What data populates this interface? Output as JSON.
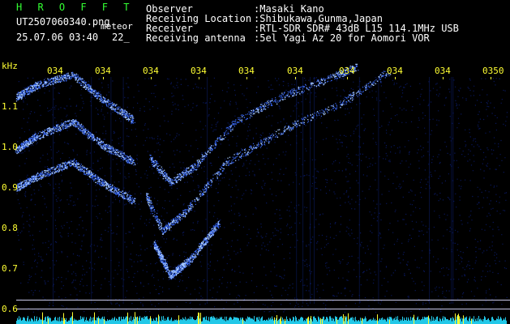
{
  "header": {
    "app_name": "H R O F F T",
    "filename": "UT2507060340.png",
    "meteor_label": "meteor",
    "datetime": "25.07.06 03:40",
    "count": "22_",
    "fields": [
      {
        "label": "Observer",
        "value": ":Masaki Kano"
      },
      {
        "label": "Receiving Location",
        "value": ":Shibukawa,Gunma,Japan"
      },
      {
        "label": "Receiver",
        "value": ":RTL-SDR SDR# 43dB L15 114.1MHz USB"
      },
      {
        "label": "Receiving antenna",
        "value": ":5el Yagi Az 20 for Aomori VOR"
      }
    ]
  },
  "spectrogram": {
    "y_unit": "kHz",
    "y_ticks": [
      "1.1",
      "1.0",
      "0.9",
      "0.8",
      "0.7",
      "0.6"
    ],
    "time_ticks": [
      "034",
      "034",
      "034",
      "034",
      "034",
      "034",
      "034",
      "034",
      "034",
      "0350"
    ],
    "colors": {
      "text": "#ffffff",
      "title": "#33ff33",
      "ticks": "#ffff33",
      "signal": "#3a6cff"
    }
  }
}
